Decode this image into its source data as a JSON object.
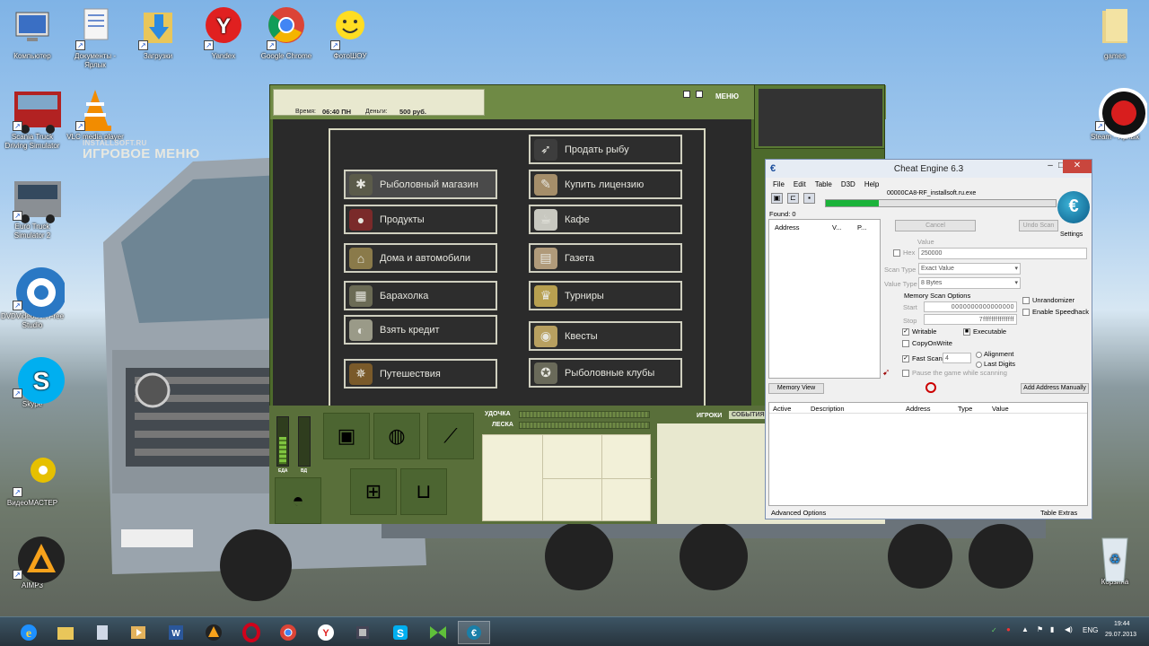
{
  "desktop": {
    "icons": [
      {
        "label": "Компьютер",
        "icon": "computer-icon"
      },
      {
        "label": "Документы - Ярлык",
        "icon": "documents-icon"
      },
      {
        "label": "Загрузки",
        "icon": "downloads-icon"
      },
      {
        "label": "Yandex",
        "icon": "yandex-icon"
      },
      {
        "label": "Google Chrome",
        "icon": "chrome-icon"
      },
      {
        "label": "ФотоШОУ",
        "icon": "smiley-icon"
      },
      {
        "label": "games",
        "icon": "folder-icon"
      },
      {
        "label": "Scania Truck Driving Simulator",
        "icon": "truck-icon"
      },
      {
        "label": "VLC media player",
        "icon": "vlc-icon"
      },
      {
        "label": "Steam - Ярлык",
        "icon": "steam-icon"
      },
      {
        "label": "Euro Truck Simulator 2",
        "icon": "truck-icon"
      },
      {
        "label": "DVDVideoSoft Free Studio",
        "icon": "gear-icon"
      },
      {
        "label": "Skype",
        "icon": "skype-icon"
      },
      {
        "label": "ВидеоМАСТЕР",
        "icon": "film-icon"
      },
      {
        "label": "AIMP3",
        "icon": "aimp-icon"
      },
      {
        "label": "Корзина",
        "icon": "recycle-bin-icon"
      }
    ]
  },
  "game": {
    "time_label": "Время:",
    "time_value": "06:40 ПН",
    "money_label": "Деньги:",
    "money_value": "500 руб.",
    "menu_button": "МЕНЮ",
    "site": "INSTALLSOFT.RU",
    "title": "ИГРОВОЕ МЕНЮ",
    "left_items": [
      "Рыболовный магазин",
      "Продукты",
      "Дома и автомобили",
      "Барахолка",
      "Взять кредит",
      "Путешествия"
    ],
    "right_items": [
      "Продать рыбу",
      "Купить лицензию",
      "Кафе",
      "Газета",
      "Турниры",
      "Квесты",
      "Рыболовные клубы"
    ],
    "rod_label": "УДОЧКА",
    "line_label": "ЛЕСКА",
    "food_label": "ЕДА",
    "water_label": "ВД",
    "players_tab": "ИГРОКИ",
    "events_tab": "СОБЫТИЯ"
  },
  "ce": {
    "title": "Cheat Engine 6.3",
    "menu": [
      "File",
      "Edit",
      "Table",
      "D3D",
      "Help"
    ],
    "process": "00000CA8-RF_installsoft.ru.exe",
    "progress_value": 0.23,
    "found": "Found: 0",
    "col_address": "Address",
    "col_v": "V...",
    "col_p": "P...",
    "cancel": "Cancel",
    "undo": "Undo Scan",
    "settings": "Settings",
    "value_label": "Value",
    "hex": "Hex",
    "value": "250000",
    "scan_type_label": "Scan Type",
    "scan_type": "Exact Value",
    "value_type_label": "Value Type",
    "value_type": "8 Bytes",
    "mem_opts": "Memory Scan Options",
    "start_label": "Start",
    "start": "0000000000000000",
    "stop_label": "Stop",
    "stop": "7fffffffffffffff",
    "writable": "Writable",
    "executable": "Executable",
    "copyonwrite": "CopyOnWrite",
    "fast_scan": "Fast Scan",
    "fast_scan_val": "4",
    "alignment": "Alignment",
    "last_digits": "Last Digits",
    "pause": "Pause the game while scanning",
    "unrandomizer": "Unrandomizer",
    "speedhack": "Enable Speedhack",
    "memory_view": "Memory View",
    "add_manually": "Add Address Manually",
    "tbl_active": "Active",
    "tbl_desc": "Description",
    "tbl_address": "Address",
    "tbl_type": "Type",
    "tbl_value": "Value",
    "advanced": "Advanced Options",
    "extras": "Table Extras"
  },
  "taskbar": {
    "items": [
      "ie-icon",
      "explorer-icon",
      "files-icon",
      "media-icon",
      "word-icon",
      "aimp-icon",
      "opera-icon",
      "chrome-icon",
      "yandex-icon",
      "ce-icon",
      "skype-icon",
      "game-icon",
      "cheat-engine-icon"
    ],
    "lang": "ENG",
    "time": "19:44",
    "date": "29.07.2013"
  }
}
